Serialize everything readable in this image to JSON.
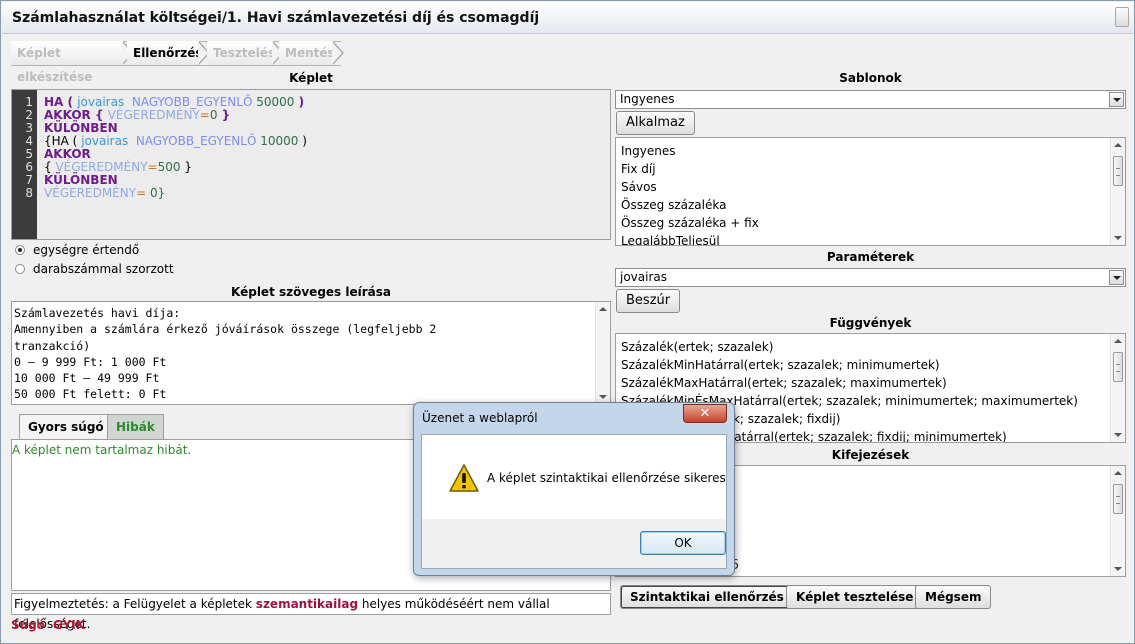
{
  "window": {
    "title": "Számlahasználat költségei/1. Havi számlavezetési díj és csomagdíj"
  },
  "steps": [
    {
      "label": "Képlet elkészítése",
      "active": false
    },
    {
      "label": "Ellenőrzés",
      "active": true
    },
    {
      "label": "Tesztelés",
      "active": false
    },
    {
      "label": "Mentés",
      "active": false
    }
  ],
  "formula": {
    "title": "Képlet",
    "line_numbers": [
      "1",
      "2",
      "3",
      "4",
      "5",
      "6",
      "7",
      "8"
    ],
    "lines": [
      [
        {
          "t": "HA",
          "c": "kw"
        },
        {
          "t": " ( ",
          "c": "kw"
        },
        {
          "t": "jovairas",
          "c": "var"
        },
        {
          "t": "  NAGYOBB_EGYENLŐ ",
          "c": "op"
        },
        {
          "t": "50000",
          "c": "num"
        },
        {
          "t": " )",
          "c": "kw"
        }
      ],
      [
        {
          "t": "AKKOR",
          "c": "kw"
        },
        {
          "t": " { ",
          "c": "kw"
        },
        {
          "t": "VÉGEREDMÉNY",
          "c": "res"
        },
        {
          "t": "=",
          "c": "res-eq"
        },
        {
          "t": "0",
          "c": "num"
        },
        {
          "t": " }",
          "c": "kw"
        }
      ],
      [
        {
          "t": "KÜLÖNBEN",
          "c": "kw"
        }
      ],
      [
        {
          "t": "{HA ( ",
          "c": ""
        },
        {
          "t": "jovairas",
          "c": "var"
        },
        {
          "t": "  NAGYOBB_EGYENLŐ ",
          "c": "op"
        },
        {
          "t": "10000",
          "c": "num"
        },
        {
          "t": " )",
          "c": ""
        }
      ],
      [
        {
          "t": "AKKOR",
          "c": "kw"
        }
      ],
      [
        {
          "t": "{ ",
          "c": ""
        },
        {
          "t": "VÉGEREDMÉNY",
          "c": "res"
        },
        {
          "t": "=",
          "c": "res-eq"
        },
        {
          "t": "500",
          "c": "num"
        },
        {
          "t": " }",
          "c": ""
        }
      ],
      [
        {
          "t": "KÜLÖNBEN",
          "c": "kw"
        }
      ],
      [
        {
          "t": "VÉGEREDMÉNY",
          "c": "res"
        },
        {
          "t": "=",
          "c": "res-eq"
        },
        {
          "t": " 0}",
          "c": "num"
        }
      ]
    ]
  },
  "radios": [
    {
      "label": "egységre értendő",
      "checked": true
    },
    {
      "label": "darabszámmal szorzott",
      "checked": false
    }
  ],
  "description": {
    "title": "Képlet szöveges leírása",
    "text": "Számlavezetés havi díja:\nAmennyiben a számlára érkező jóváírások összege (legfeljebb 2\ntranzakció)\n0 – 9 999 Ft: 1 000 Ft\n10 000 Ft – 49 999 Ft\n50 000 Ft felett: 0 Ft"
  },
  "tabs": [
    {
      "label": "Gyors súgó",
      "active": false
    },
    {
      "label": "Hibák",
      "active": true
    }
  ],
  "errors_message": "A képlet nem tartalmaz hibát.",
  "warning": {
    "prefix": "Figyelmeztetés: a Felügyelet a képletek ",
    "highlight": "szemantikailag",
    "suffix": " helyes működéséért nem vállal felelősséget."
  },
  "footer_links": [
    "Súgó",
    "GYIK"
  ],
  "templates": {
    "title": "Sablonok",
    "selected": "Ingyenes",
    "apply_label": "Alkalmaz",
    "items": [
      "Ingyenes",
      "Fix díj",
      "Sávos",
      "Összeg százaléka",
      "Összeg százaléka + fix",
      "LegalábbTeljesül"
    ]
  },
  "parameters": {
    "title": "Paraméterek",
    "selected": "jovairas",
    "insert_label": "Beszúr"
  },
  "functions": {
    "title": "Függvények",
    "items": [
      "Százalék(ertek; szazalek)",
      "SzázalékMinHatárral(ertek; szazalek; minimumertek)",
      "SzázalékMaxHatárral(ertek; szazalek; maximumertek)",
      "SzázalékMinÉsMaxHatárral(ertek; szazalek; minimumertek; maximumertek)",
      "SzázalékÉsFix(ertek; szazalek; fixdij)",
      "SzázalékÉsFixMinHatárral(ertek; szazalek; fixdij; minimumertek)"
    ]
  },
  "expressions": {
    "title": "Kifejezések",
    "partial_text": "5"
  },
  "actions": {
    "syntax_check": "Szintaktikai ellenőrzés",
    "test": "Képlet tesztelése",
    "cancel": "Mégsem"
  },
  "dialog": {
    "title": "Üzenet a weblapról",
    "close": "✕",
    "message": "A képlet szintaktikai ellenőrzése sikeres",
    "ok": "OK"
  }
}
